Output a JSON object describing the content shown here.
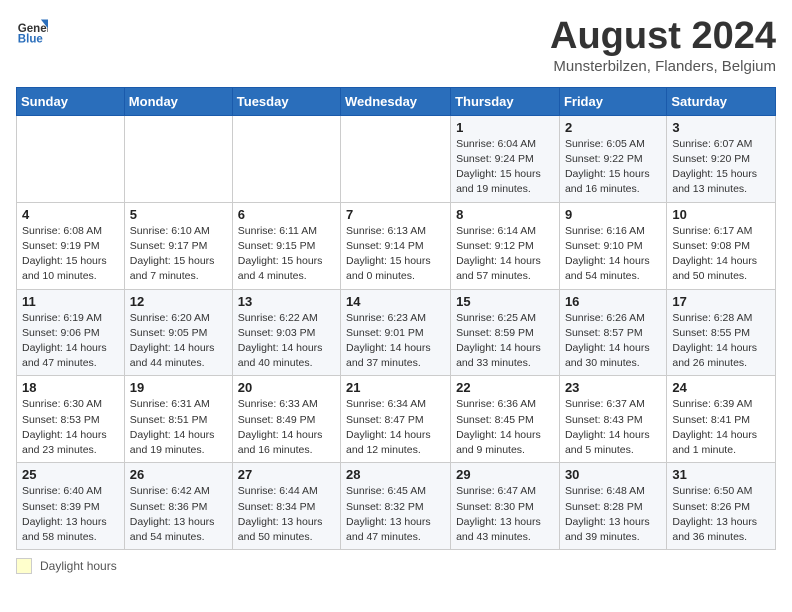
{
  "header": {
    "logo_line1": "General",
    "logo_line2": "Blue",
    "month_title": "August 2024",
    "location": "Munsterbilzen, Flanders, Belgium"
  },
  "days_of_week": [
    "Sunday",
    "Monday",
    "Tuesday",
    "Wednesday",
    "Thursday",
    "Friday",
    "Saturday"
  ],
  "weeks": [
    [
      {
        "day": "",
        "info": ""
      },
      {
        "day": "",
        "info": ""
      },
      {
        "day": "",
        "info": ""
      },
      {
        "day": "",
        "info": ""
      },
      {
        "day": "1",
        "info": "Sunrise: 6:04 AM\nSunset: 9:24 PM\nDaylight: 15 hours\nand 19 minutes."
      },
      {
        "day": "2",
        "info": "Sunrise: 6:05 AM\nSunset: 9:22 PM\nDaylight: 15 hours\nand 16 minutes."
      },
      {
        "day": "3",
        "info": "Sunrise: 6:07 AM\nSunset: 9:20 PM\nDaylight: 15 hours\nand 13 minutes."
      }
    ],
    [
      {
        "day": "4",
        "info": "Sunrise: 6:08 AM\nSunset: 9:19 PM\nDaylight: 15 hours\nand 10 minutes."
      },
      {
        "day": "5",
        "info": "Sunrise: 6:10 AM\nSunset: 9:17 PM\nDaylight: 15 hours\nand 7 minutes."
      },
      {
        "day": "6",
        "info": "Sunrise: 6:11 AM\nSunset: 9:15 PM\nDaylight: 15 hours\nand 4 minutes."
      },
      {
        "day": "7",
        "info": "Sunrise: 6:13 AM\nSunset: 9:14 PM\nDaylight: 15 hours\nand 0 minutes."
      },
      {
        "day": "8",
        "info": "Sunrise: 6:14 AM\nSunset: 9:12 PM\nDaylight: 14 hours\nand 57 minutes."
      },
      {
        "day": "9",
        "info": "Sunrise: 6:16 AM\nSunset: 9:10 PM\nDaylight: 14 hours\nand 54 minutes."
      },
      {
        "day": "10",
        "info": "Sunrise: 6:17 AM\nSunset: 9:08 PM\nDaylight: 14 hours\nand 50 minutes."
      }
    ],
    [
      {
        "day": "11",
        "info": "Sunrise: 6:19 AM\nSunset: 9:06 PM\nDaylight: 14 hours\nand 47 minutes."
      },
      {
        "day": "12",
        "info": "Sunrise: 6:20 AM\nSunset: 9:05 PM\nDaylight: 14 hours\nand 44 minutes."
      },
      {
        "day": "13",
        "info": "Sunrise: 6:22 AM\nSunset: 9:03 PM\nDaylight: 14 hours\nand 40 minutes."
      },
      {
        "day": "14",
        "info": "Sunrise: 6:23 AM\nSunset: 9:01 PM\nDaylight: 14 hours\nand 37 minutes."
      },
      {
        "day": "15",
        "info": "Sunrise: 6:25 AM\nSunset: 8:59 PM\nDaylight: 14 hours\nand 33 minutes."
      },
      {
        "day": "16",
        "info": "Sunrise: 6:26 AM\nSunset: 8:57 PM\nDaylight: 14 hours\nand 30 minutes."
      },
      {
        "day": "17",
        "info": "Sunrise: 6:28 AM\nSunset: 8:55 PM\nDaylight: 14 hours\nand 26 minutes."
      }
    ],
    [
      {
        "day": "18",
        "info": "Sunrise: 6:30 AM\nSunset: 8:53 PM\nDaylight: 14 hours\nand 23 minutes."
      },
      {
        "day": "19",
        "info": "Sunrise: 6:31 AM\nSunset: 8:51 PM\nDaylight: 14 hours\nand 19 minutes."
      },
      {
        "day": "20",
        "info": "Sunrise: 6:33 AM\nSunset: 8:49 PM\nDaylight: 14 hours\nand 16 minutes."
      },
      {
        "day": "21",
        "info": "Sunrise: 6:34 AM\nSunset: 8:47 PM\nDaylight: 14 hours\nand 12 minutes."
      },
      {
        "day": "22",
        "info": "Sunrise: 6:36 AM\nSunset: 8:45 PM\nDaylight: 14 hours\nand 9 minutes."
      },
      {
        "day": "23",
        "info": "Sunrise: 6:37 AM\nSunset: 8:43 PM\nDaylight: 14 hours\nand 5 minutes."
      },
      {
        "day": "24",
        "info": "Sunrise: 6:39 AM\nSunset: 8:41 PM\nDaylight: 14 hours\nand 1 minute."
      }
    ],
    [
      {
        "day": "25",
        "info": "Sunrise: 6:40 AM\nSunset: 8:39 PM\nDaylight: 13 hours\nand 58 minutes."
      },
      {
        "day": "26",
        "info": "Sunrise: 6:42 AM\nSunset: 8:36 PM\nDaylight: 13 hours\nand 54 minutes."
      },
      {
        "day": "27",
        "info": "Sunrise: 6:44 AM\nSunset: 8:34 PM\nDaylight: 13 hours\nand 50 minutes."
      },
      {
        "day": "28",
        "info": "Sunrise: 6:45 AM\nSunset: 8:32 PM\nDaylight: 13 hours\nand 47 minutes."
      },
      {
        "day": "29",
        "info": "Sunrise: 6:47 AM\nSunset: 8:30 PM\nDaylight: 13 hours\nand 43 minutes."
      },
      {
        "day": "30",
        "info": "Sunrise: 6:48 AM\nSunset: 8:28 PM\nDaylight: 13 hours\nand 39 minutes."
      },
      {
        "day": "31",
        "info": "Sunrise: 6:50 AM\nSunset: 8:26 PM\nDaylight: 13 hours\nand 36 minutes."
      }
    ]
  ],
  "footer": {
    "daylight_label": "Daylight hours"
  }
}
